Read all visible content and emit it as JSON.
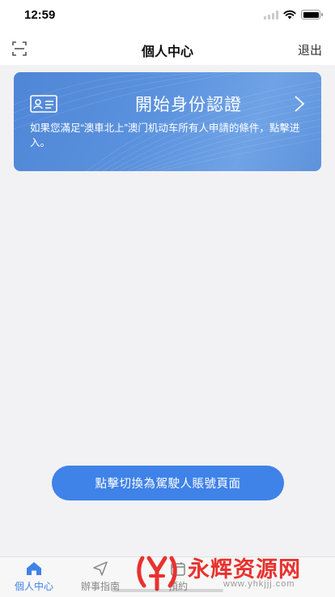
{
  "status_bar": {
    "time": "12:59"
  },
  "nav": {
    "title": "個人中心",
    "logout_label": "退出"
  },
  "id_card": {
    "title": "開始身份認證",
    "description": "如果您滿足“澳車北上”澳门机动车所有人申請的條件，點擊进入。"
  },
  "switch_button": {
    "label": "點擊切換為駕駛人賬號頁面"
  },
  "tab_bar": {
    "items": [
      {
        "label": "個人中心"
      },
      {
        "label": "辦事指南"
      },
      {
        "label": "預約"
      }
    ]
  },
  "watermark": {
    "text": "永辉资源网",
    "url": "www.yhkjjj.com"
  },
  "colors": {
    "accent": "#3f82e8",
    "card": "#5b92de",
    "watermark": "#e8322f"
  }
}
